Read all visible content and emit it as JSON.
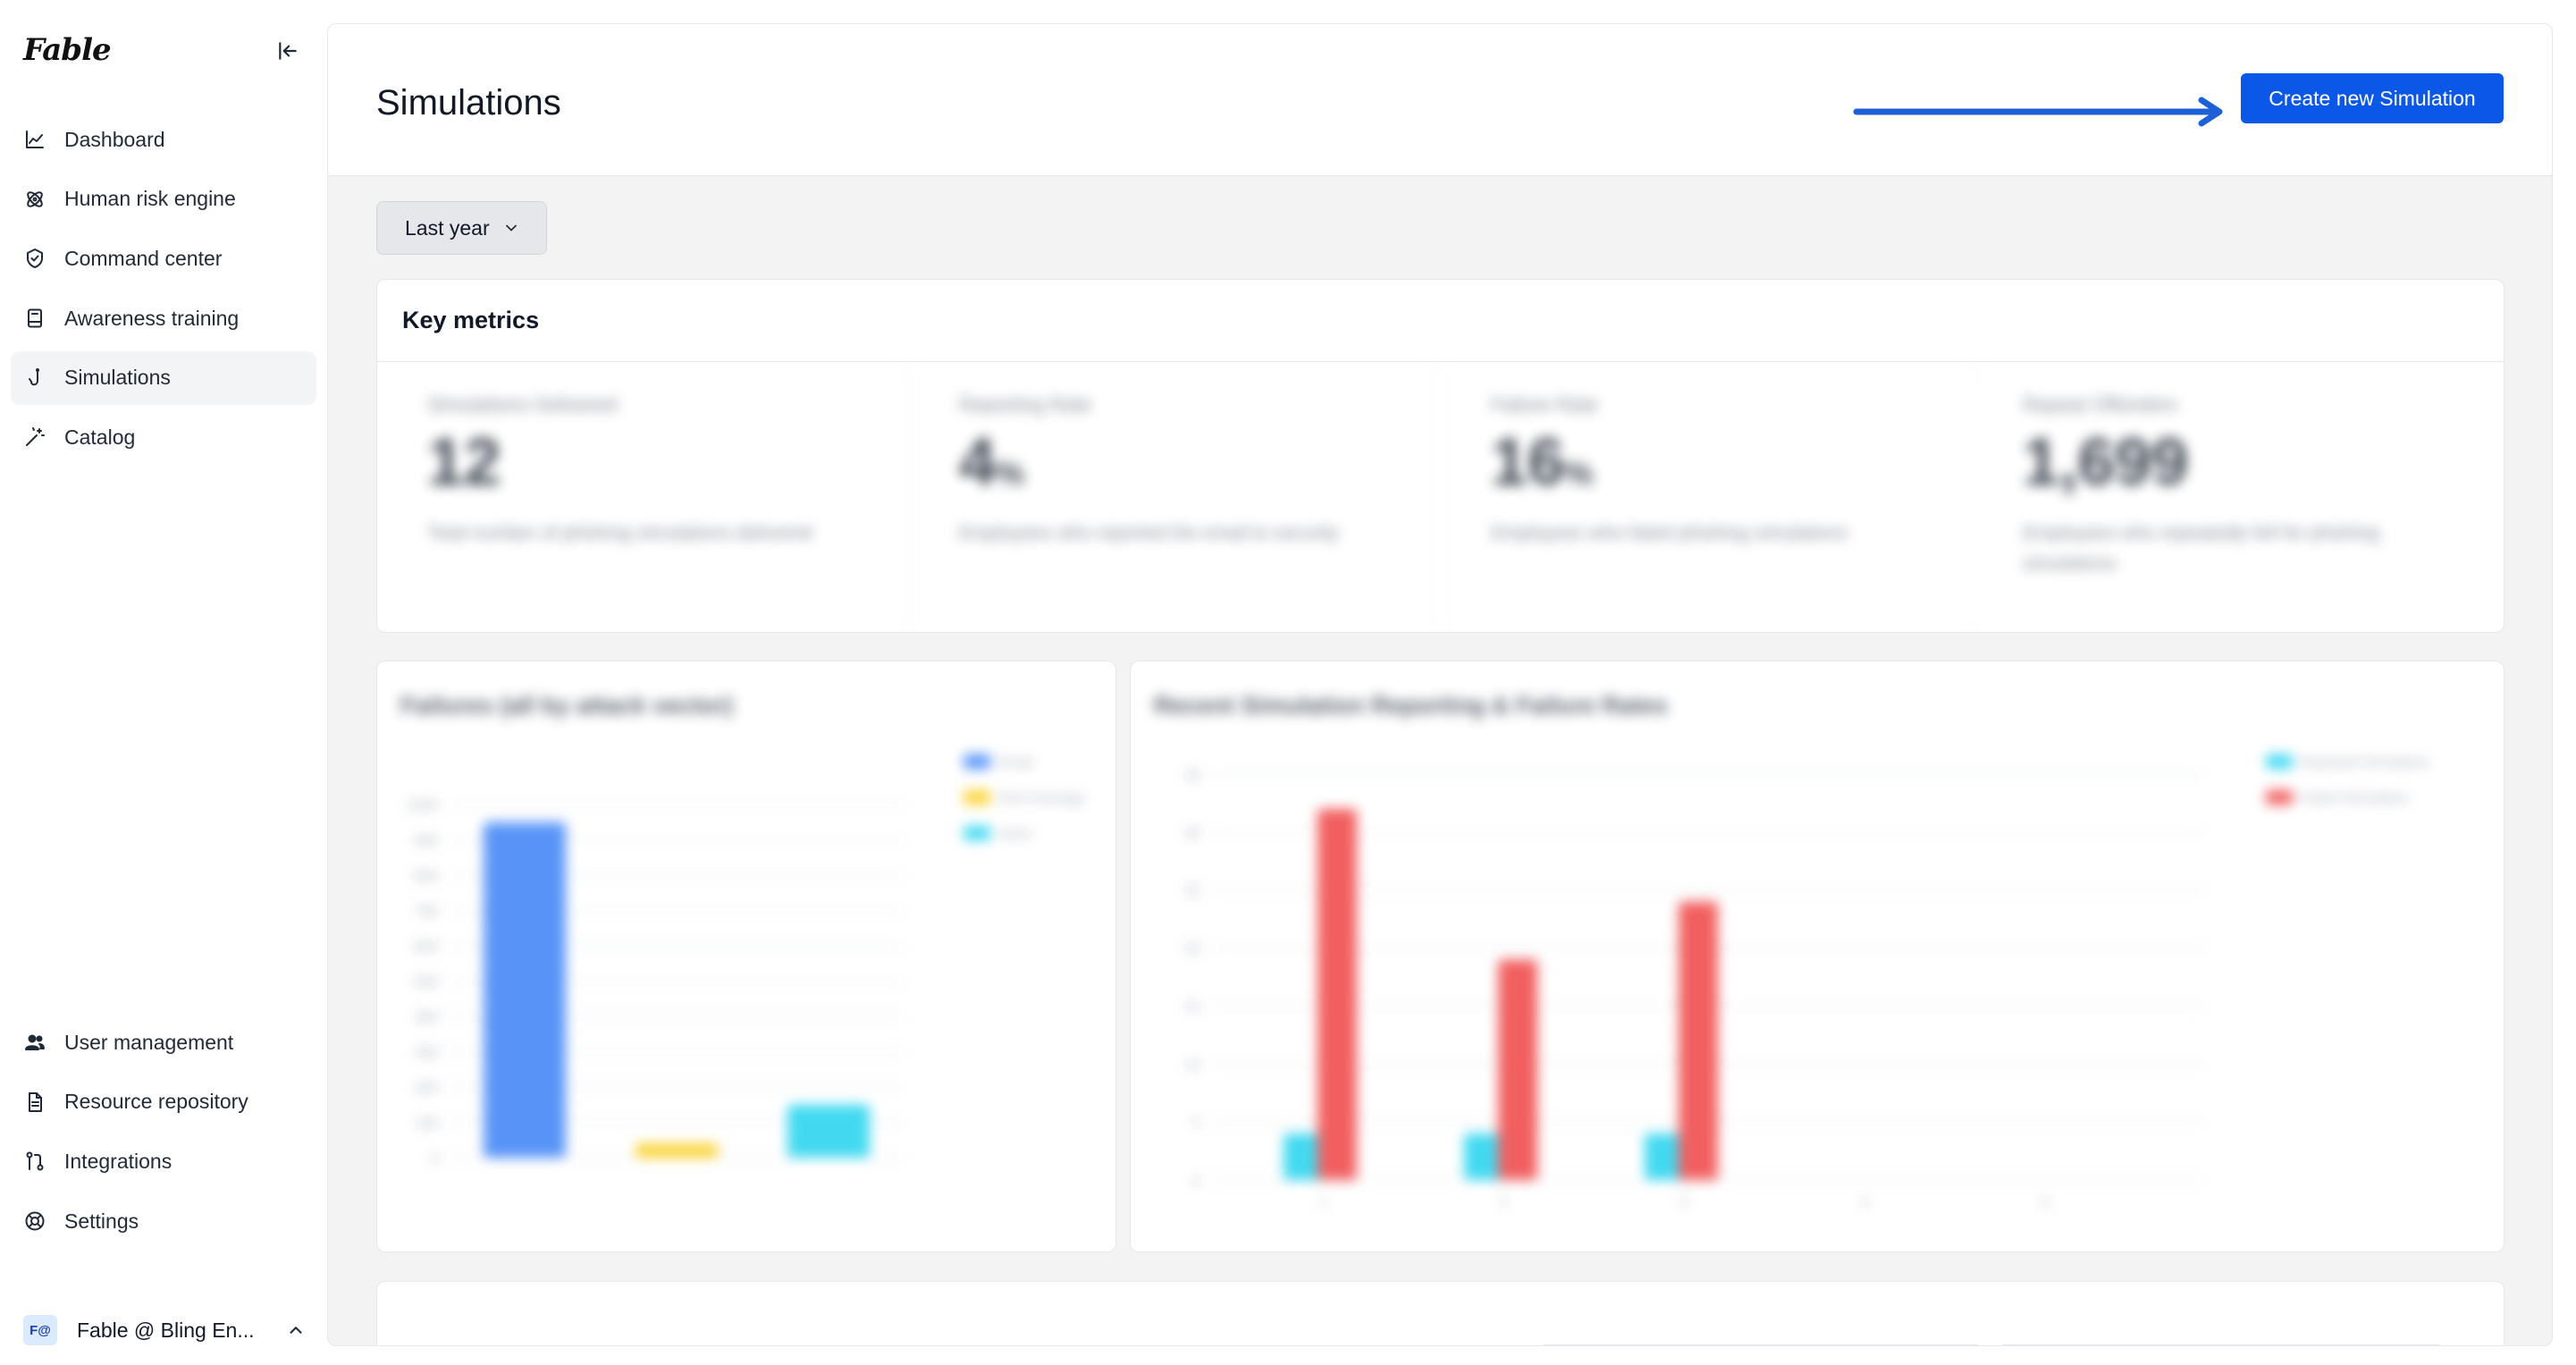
{
  "app": {
    "logo": "Fable"
  },
  "sidebar": {
    "items": [
      {
        "label": "Dashboard",
        "icon": "line-chart-icon"
      },
      {
        "label": "Human risk engine",
        "icon": "atom-icon"
      },
      {
        "label": "Command center",
        "icon": "shield-check-icon"
      },
      {
        "label": "Awareness training",
        "icon": "book-icon"
      },
      {
        "label": "Simulations",
        "icon": "fish-hook-icon",
        "active": true
      },
      {
        "label": "Catalog",
        "icon": "magic-wand-icon"
      }
    ],
    "bottom_items": [
      {
        "label": "User management",
        "icon": "users-icon"
      },
      {
        "label": "Resource repository",
        "icon": "file-icon"
      },
      {
        "label": "Integrations",
        "icon": "git-pull-icon"
      },
      {
        "label": "Settings",
        "icon": "lifebuoy-icon"
      }
    ],
    "account": {
      "avatar": "F@",
      "name": "Fable @ Bling En..."
    }
  },
  "header": {
    "title": "Simulations",
    "create_button": "Create new Simulation"
  },
  "filters": {
    "range": "Last year"
  },
  "key_metrics": {
    "title": "Key metrics",
    "items": [
      {
        "label": "Simulations Delivered",
        "value": "12",
        "unit": "",
        "desc": "Total number of phishing simulations delivered"
      },
      {
        "label": "Reporting Rate",
        "value": "4",
        "unit": "%",
        "desc": "Employees who reported the email to security"
      },
      {
        "label": "Failure Rate",
        "value": "16",
        "unit": "%",
        "desc": "Employees who failed phishing simulations"
      },
      {
        "label": "Repeat Offenders",
        "value": "1,699",
        "unit": "",
        "desc": "Employees who repeatedly fell for phishing simulations"
      }
    ]
  },
  "charts": {
    "left_title": "Failures (all by attack vector)",
    "right_title": "Recent Simulation Reporting & Failure Rates"
  },
  "chart_data": [
    {
      "type": "bar",
      "title": "Failures (all by attack vector)",
      "categories": [
        "Email",
        "Text message",
        "Voice"
      ],
      "values": [
        950,
        40,
        150
      ],
      "ylim": [
        0,
        1000
      ],
      "legend": [
        "Email",
        "Text message",
        "Voice"
      ],
      "colors": [
        "#3b82f6",
        "#facc15",
        "#22d3ee"
      ],
      "legend_position": "top-right",
      "grid": true
    },
    {
      "type": "bar",
      "title": "Recent Simulation Reporting & Failure Rates",
      "categories": [
        "1",
        "2",
        "3",
        "4",
        "5"
      ],
      "series": [
        {
          "name": "Reported Simulation",
          "values": [
            4,
            4,
            4,
            0,
            0
          ],
          "color": "#22d3ee"
        },
        {
          "name": "Failed Simulation",
          "values": [
            32,
            19,
            24,
            0,
            0
          ],
          "color": "#ef4444"
        }
      ],
      "ylim": [
        0,
        35
      ],
      "legend_position": "top-right",
      "grid": true
    }
  ]
}
